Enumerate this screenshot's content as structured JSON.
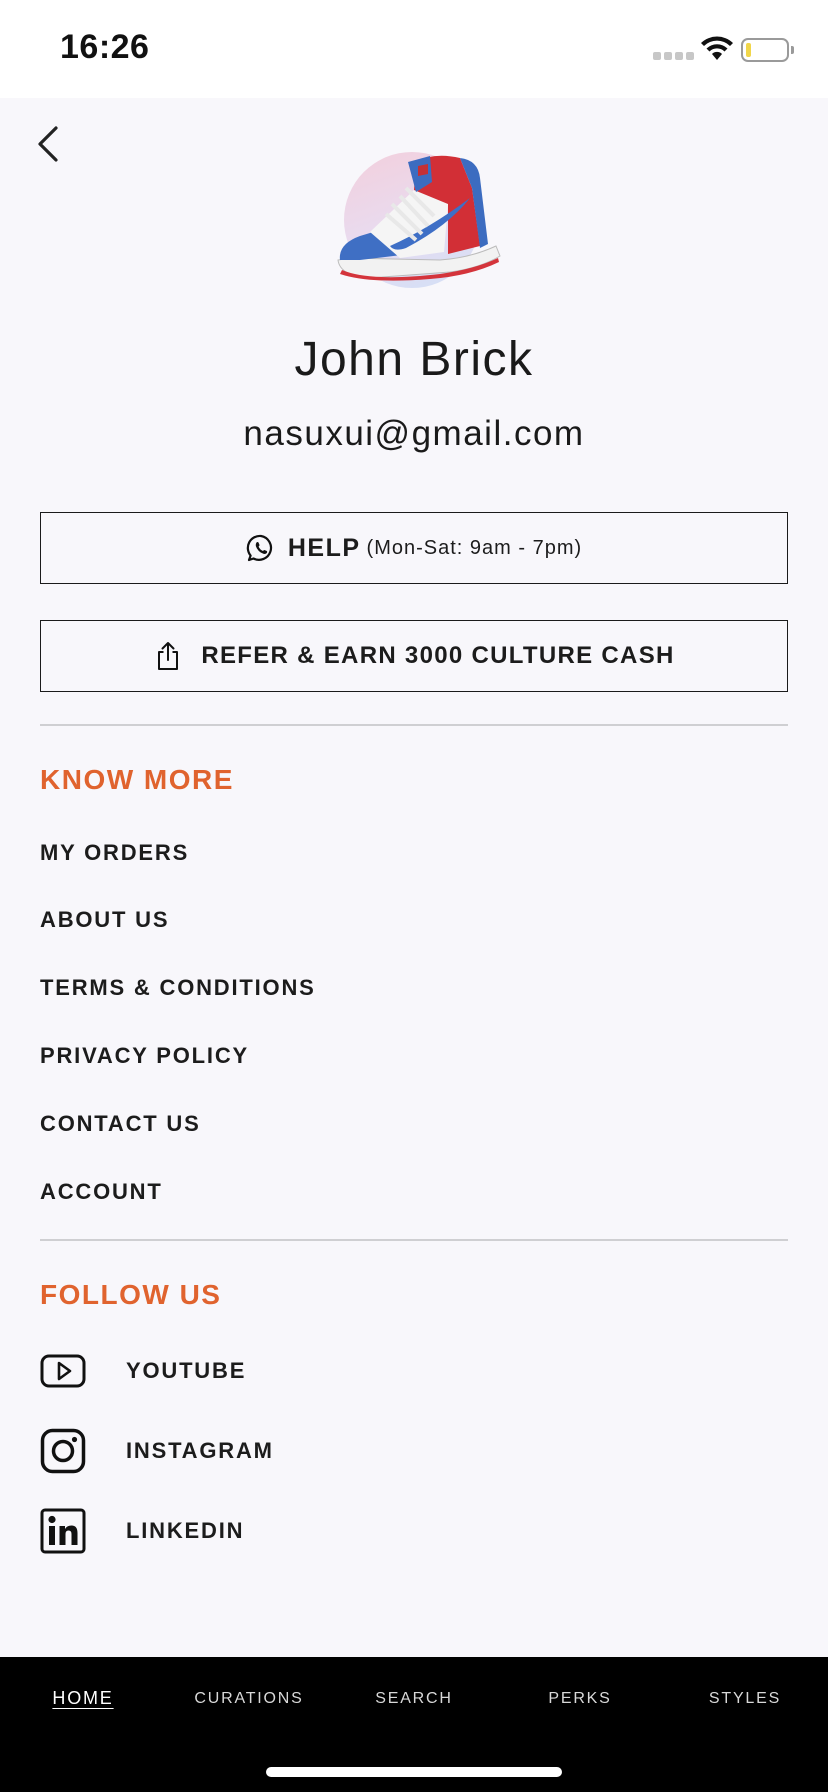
{
  "status_bar": {
    "time": "16:26"
  },
  "profile": {
    "name": "John Brick",
    "email": "nasuxui@gmail.com",
    "avatar_icon": "sneaker-avatar"
  },
  "actions": {
    "help_label": "HELP",
    "help_hours": "(Mon-Sat: 9am - 7pm)",
    "refer_label": "REFER & EARN 3000 CULTURE CASH"
  },
  "know_more": {
    "title": "KNOW MORE",
    "items": [
      {
        "label": "MY ORDERS"
      },
      {
        "label": "ABOUT US"
      },
      {
        "label": "TERMS & CONDITIONS"
      },
      {
        "label": "PRIVACY POLICY"
      },
      {
        "label": "CONTACT US"
      },
      {
        "label": "ACCOUNT"
      }
    ]
  },
  "follow_us": {
    "title": "FOLLOW US",
    "items": [
      {
        "label": "YOUTUBE",
        "icon": "youtube-icon"
      },
      {
        "label": "INSTAGRAM",
        "icon": "instagram-icon"
      },
      {
        "label": "LINKEDIN",
        "icon": "linkedin-icon"
      }
    ]
  },
  "bottom_nav": {
    "items": [
      {
        "label": "HOME"
      },
      {
        "label": "CURATIONS"
      },
      {
        "label": "SEARCH"
      },
      {
        "label": "PERKS"
      },
      {
        "label": "STYLES"
      }
    ],
    "active": "HOME"
  },
  "colors": {
    "accent": "#e0632e",
    "background": "#f8f7fb",
    "nav_background": "#000000"
  }
}
